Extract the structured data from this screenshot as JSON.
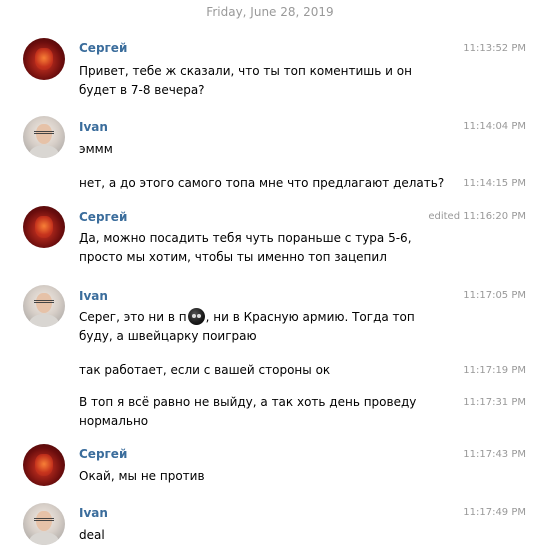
{
  "date_header": "Friday, June 28, 2019",
  "messages": {
    "m1": {
      "author": "Сергей",
      "time": "11:13:52 PM",
      "text": "Привет, тебе ж сказали, что ты топ коментишь и он будет в 7-8 вечера?"
    },
    "m2": {
      "author": "Ivan",
      "time": "11:14:04 PM",
      "text": "эммм"
    },
    "m3": {
      "time": "11:14:15 PM",
      "text": "нет, а до этого самого топа мне что предлагают делать?"
    },
    "m4": {
      "author": "Сергей",
      "time": "edited 11:16:20 PM",
      "text": "Да, можно посадить тебя чуть пораньше с тура 5-6, просто мы хотим, чтобы ты именно топ зацепил"
    },
    "m5": {
      "author": "Ivan",
      "time": "11:17:05 PM",
      "text_before": "Серег, это ни в п",
      "text_after": ", ни в Красную армию. Тогда топ буду, а швейцарку поиграю",
      "emoji": "pirate-skull-emoji"
    },
    "m6": {
      "time": "11:17:19 PM",
      "text": "так работает, если с вашей стороны ок"
    },
    "m7": {
      "time": "11:17:31 PM",
      "text": "В топ я всё равно не выйду, а так хоть день проведу нормально"
    },
    "m8": {
      "author": "Сергей",
      "time": "11:17:43 PM",
      "text": "Окай, мы не против"
    },
    "m9": {
      "author": "Ivan",
      "time": "11:17:49 PM",
      "text": "deal"
    }
  },
  "colors": {
    "author_name": "#3b6d9c",
    "timestamp": "#999999",
    "date_header": "#999999"
  }
}
